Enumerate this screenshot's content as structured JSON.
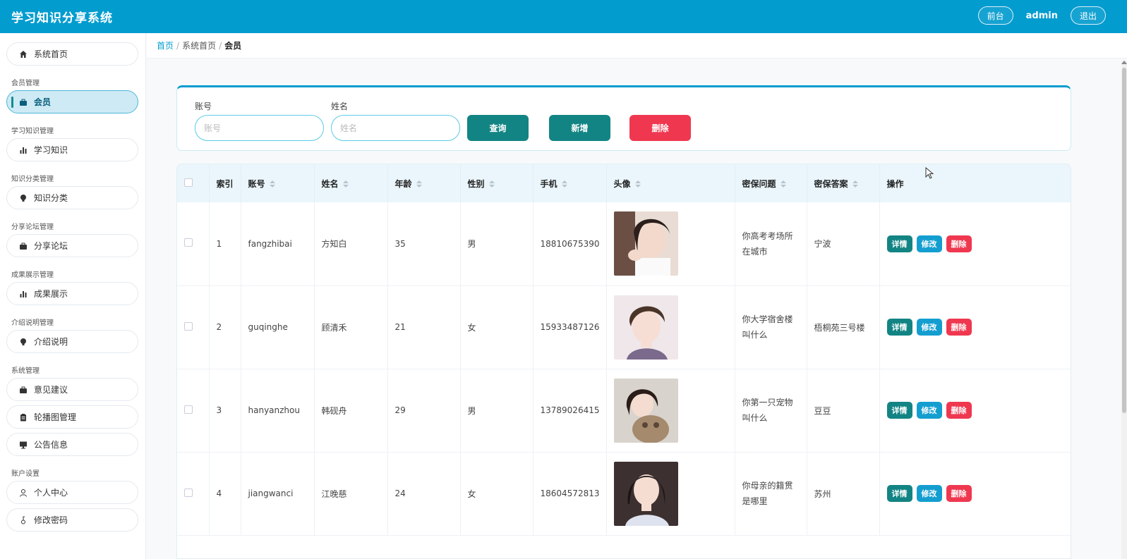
{
  "header": {
    "title": "学习知识分享系统",
    "front_label": "前台",
    "user": "admin",
    "logout_label": "退出"
  },
  "sidebar": {
    "home": "系统首页",
    "groups": [
      {
        "label": "会员管理",
        "items": [
          "会员"
        ]
      },
      {
        "label": "学习知识管理",
        "items": [
          "学习知识"
        ]
      },
      {
        "label": "知识分类管理",
        "items": [
          "知识分类"
        ]
      },
      {
        "label": "分享论坛管理",
        "items": [
          "分享论坛"
        ]
      },
      {
        "label": "成果展示管理",
        "items": [
          "成果展示"
        ]
      },
      {
        "label": "介绍说明管理",
        "items": [
          "介绍说明"
        ]
      },
      {
        "label": "系统管理",
        "items": [
          "意见建议",
          "轮播图管理",
          "公告信息"
        ]
      },
      {
        "label": "账户设置",
        "items": [
          "个人中心",
          "修改密码"
        ]
      }
    ],
    "icons": [
      "home-icon",
      "briefcase-icon",
      "bar-chart-icon",
      "bulb-icon",
      "clipboard-icon",
      "monitor-icon",
      "user-icon",
      "key-icon"
    ]
  },
  "breadcrumb": {
    "home": "首页",
    "middle": "系统首页",
    "current": "会员"
  },
  "search": {
    "account_label": "账号",
    "account_placeholder": "账号",
    "name_label": "姓名",
    "name_placeholder": "姓名",
    "query_button": "查询",
    "add_button": "新增",
    "delete_button": "删除"
  },
  "table": {
    "columns": [
      "索引",
      "账号",
      "姓名",
      "年龄",
      "性别",
      "手机",
      "头像",
      "密保问题",
      "密保答案",
      "操作"
    ],
    "rows": [
      {
        "index": "1",
        "account": "fangzhibai",
        "name": "方知白",
        "age": "35",
        "gender": "男",
        "phone": "18810675390",
        "question": "你高考考场所在城市",
        "answer": "宁波"
      },
      {
        "index": "2",
        "account": "guqinghe",
        "name": "顾清禾",
        "age": "21",
        "gender": "女",
        "phone": "15933487126",
        "question": "你大学宿舍楼叫什么",
        "answer": "梧桐苑三号楼"
      },
      {
        "index": "3",
        "account": "hanyanzhou",
        "name": "韩砚舟",
        "age": "29",
        "gender": "男",
        "phone": "13789026415",
        "question": "你第一只宠物叫什么",
        "answer": "豆豆"
      },
      {
        "index": "4",
        "account": "jiangwanci",
        "name": "江晚慈",
        "age": "24",
        "gender": "女",
        "phone": "18604572813",
        "question": "你母亲的籍贯是哪里",
        "answer": "苏州"
      }
    ],
    "ops": {
      "detail": "详情",
      "edit": "修改",
      "delete": "删除"
    }
  },
  "colors": {
    "header_bg": "#039ccf",
    "teal": "#138484",
    "blue": "#149ed0",
    "red": "#ef3850",
    "active_nav_bg": "#cdeaf5"
  }
}
